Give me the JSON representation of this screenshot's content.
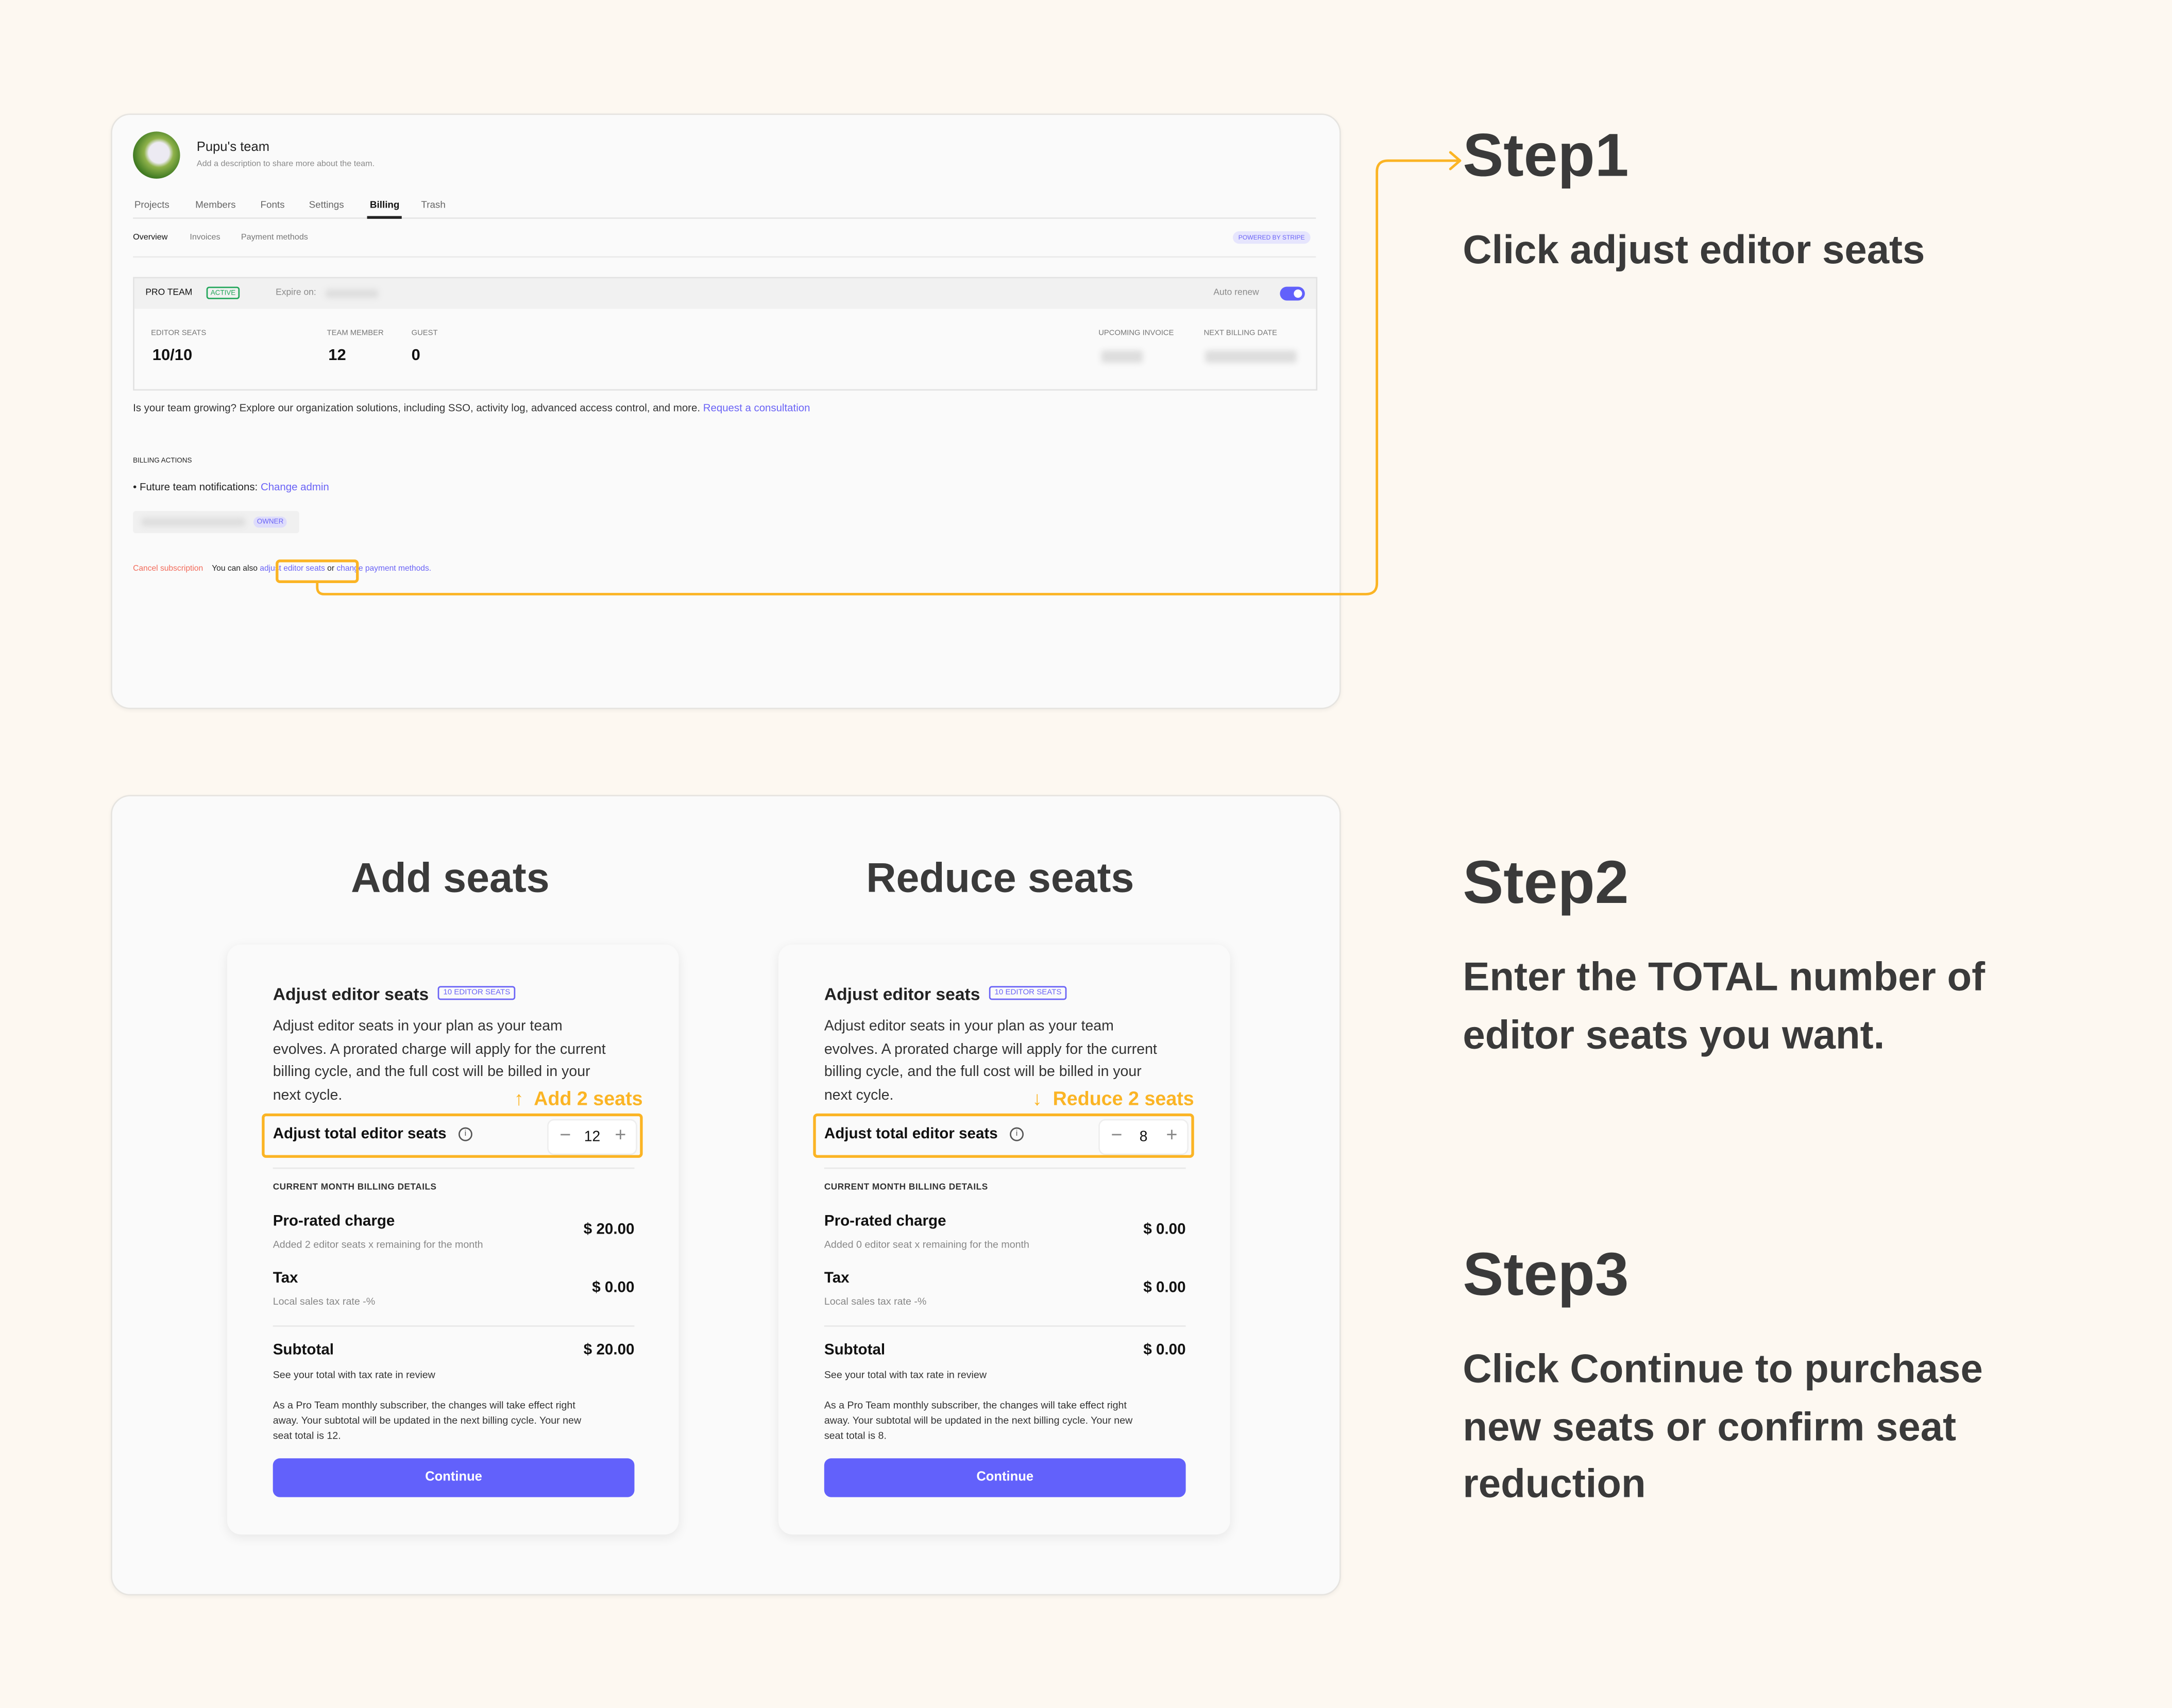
{
  "colors": {
    "accent": "#6261fb",
    "highlight": "#fbb424",
    "danger": "#f26b5b",
    "active": "#22a65a",
    "background": "#fdf8f1"
  },
  "team": {
    "name": "Pupu's team",
    "description": "Add a description to share more about the team."
  },
  "tabs": [
    {
      "label": "Projects"
    },
    {
      "label": "Members"
    },
    {
      "label": "Fonts"
    },
    {
      "label": "Settings"
    },
    {
      "label": "Billing",
      "active": true
    },
    {
      "label": "Trash"
    }
  ],
  "subtabs": [
    {
      "label": "Overview",
      "active": true
    },
    {
      "label": "Invoices"
    },
    {
      "label": "Payment methods"
    }
  ],
  "powered_by": "POWERED BY STRIPE",
  "plan": {
    "name": "PRO TEAM",
    "status": "ACTIVE",
    "expire_label": "Expire on:",
    "auto_renew_label": "Auto renew",
    "auto_renew": true,
    "stats": [
      {
        "label": "EDITOR SEATS",
        "value": "10/10"
      },
      {
        "label": "TEAM MEMBER",
        "value": "12"
      },
      {
        "label": "GUEST",
        "value": "0"
      },
      {
        "label": "UPCOMING INVOICE"
      },
      {
        "label": "NEXT BILLING DATE"
      }
    ]
  },
  "growing": {
    "text": "Is your team growing? Explore our organization solutions, including SSO, activity log, advanced access control, and more.",
    "link": "Request a consultation"
  },
  "billing_actions": {
    "heading": "BILLING ACTIONS",
    "notifications_label": "Future team notifications:",
    "change_admin": "Change admin",
    "owner_badge": "OWNER",
    "cancel": "Cancel subscription",
    "also": "You can also",
    "adjust_link": "adjust editor seats",
    "or": "or",
    "payment_link": "change payment methods."
  },
  "steps": [
    {
      "title": "Step1",
      "lines": [
        "Click adjust editor seats"
      ]
    },
    {
      "title": "Step2",
      "lines": [
        "Enter the TOTAL number of",
        "editor seats you want."
      ]
    },
    {
      "title": "Step3",
      "lines": [
        "Click Continue to purchase",
        "new seats or confirm seat",
        "reduction"
      ]
    }
  ],
  "cards": [
    {
      "heading": "Add seats",
      "title": "Adjust editor seats",
      "badge": "10 EDITOR SEATS",
      "desc": [
        "Adjust editor seats in your plan as your team",
        "evolves. A prorated charge will apply for the current",
        "billing cycle, and the full cost will be billed in your",
        "next cycle."
      ],
      "annotation_arrow": "↑",
      "annotation": "Add 2 seats",
      "stepper_label": "Adjust total editor seats",
      "stepper_value": "12",
      "details_heading": "CURRENT MONTH BILLING DETAILS",
      "prorated_label": "Pro-rated charge",
      "prorated_amount": "$ 20.00",
      "prorated_sub": "Added 2 editor seats x remaining for the month",
      "tax_label": "Tax",
      "tax_amount": "$ 0.00",
      "tax_sub": "Local sales tax rate -%",
      "subtotal_label": "Subtotal",
      "subtotal_amount": "$ 20.00",
      "subtotal_sub": "See your total with tax rate in review",
      "note": [
        "As a Pro Team monthly subscriber, the changes will take effect right",
        "away. Your subtotal will be updated in the next billing cycle. Your new",
        "seat total is 12."
      ],
      "continue": "Continue"
    },
    {
      "heading": "Reduce seats",
      "title": "Adjust editor seats",
      "badge": "10 EDITOR SEATS",
      "desc": [
        "Adjust editor seats in your plan as your team",
        "evolves. A prorated charge will apply for the current",
        "billing cycle, and the full cost will be billed in your",
        "next cycle."
      ],
      "annotation_arrow": "↓",
      "annotation": "Reduce 2 seats",
      "stepper_label": "Adjust total editor seats",
      "stepper_value": "8",
      "details_heading": "CURRENT MONTH BILLING DETAILS",
      "prorated_label": "Pro-rated charge",
      "prorated_amount": "$ 0.00",
      "prorated_sub": "Added 0 editor seat x remaining for the month",
      "tax_label": "Tax",
      "tax_amount": "$ 0.00",
      "tax_sub": "Local sales tax rate -%",
      "subtotal_label": "Subtotal",
      "subtotal_amount": "$ 0.00",
      "subtotal_sub": "See your total with tax rate in review",
      "note": [
        "As a Pro Team monthly subscriber, the changes will take effect right",
        "away. Your subtotal will be updated in the next billing cycle. Your new",
        "seat total is 8."
      ],
      "continue": "Continue"
    }
  ]
}
